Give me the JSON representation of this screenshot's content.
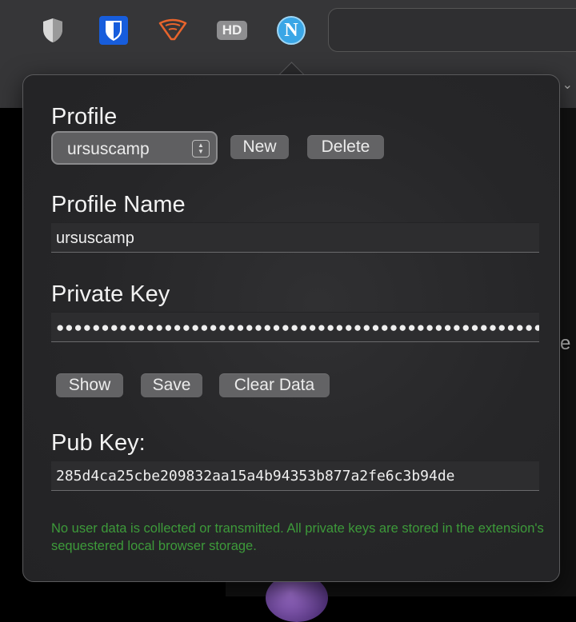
{
  "extensions": [
    {
      "name": "shield-extension"
    },
    {
      "name": "bitwarden-extension"
    },
    {
      "name": "wifi-extension"
    },
    {
      "name": "hd-extension",
      "label": "HD"
    },
    {
      "name": "nostr-extension",
      "label": "N"
    }
  ],
  "popup": {
    "profile_label": "Profile",
    "profile_select_value": "ursuscamp",
    "new_button": "New",
    "delete_button": "Delete",
    "profile_name_label": "Profile Name",
    "profile_name_value": "ursuscamp",
    "private_key_label": "Private Key",
    "private_key_masked": "●●●●●●●●●●●●●●●●●●●●●●●●●●●●●●●●●●●●●●●●●●●●●●●●●●●●●●●●●●●●●●●●",
    "show_button": "Show",
    "save_button": "Save",
    "clear_button": "Clear Data",
    "pub_key_label": "Pub Key:",
    "pub_key_value": "285d4ca25cbe209832aa15a4b94353b877a2fe6c3b94de",
    "privacy_note": "No user data is collected or transmitted. All private keys are stored in the extension's sequestered local browser storage."
  },
  "colors": {
    "note_green": "#3d9a3a",
    "nostr_blue": "#3aa6e6",
    "bitwarden_blue": "#175ddc",
    "wifi_orange": "#e8642c"
  }
}
